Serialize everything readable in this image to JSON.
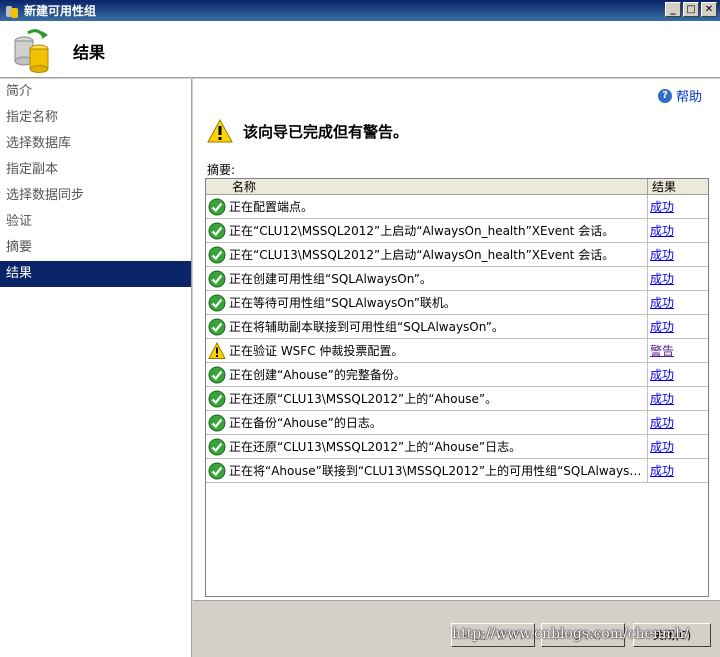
{
  "window": {
    "title": "新建可用性组"
  },
  "header": {
    "title": "结果"
  },
  "sidebar": {
    "items": [
      {
        "label": "简介"
      },
      {
        "label": "指定名称"
      },
      {
        "label": "选择数据库"
      },
      {
        "label": "指定副本"
      },
      {
        "label": "选择数据同步"
      },
      {
        "label": "验证"
      },
      {
        "label": "摘要"
      },
      {
        "label": "结果",
        "active": true
      }
    ]
  },
  "main": {
    "help_label": "帮助",
    "warning_heading": "该向导已完成但有警告。",
    "summary_label": "摘要:",
    "columns": {
      "name": "名称",
      "result": "结果"
    },
    "rows": [
      {
        "status": "success",
        "text": "正在配置端点。",
        "result": "成功"
      },
      {
        "status": "success",
        "text": "正在“CLU12\\MSSQL2012”上启动“AlwaysOn_health”XEvent 会话。",
        "result": "成功"
      },
      {
        "status": "success",
        "text": "正在“CLU13\\MSSQL2012”上启动“AlwaysOn_health”XEvent 会话。",
        "result": "成功"
      },
      {
        "status": "success",
        "text": "正在创建可用性组“SQLAlwaysOn”。",
        "result": "成功"
      },
      {
        "status": "success",
        "text": "正在等待可用性组“SQLAlwaysOn”联机。",
        "result": "成功"
      },
      {
        "status": "success",
        "text": "正在将辅助副本联接到可用性组“SQLAlwaysOn”。",
        "result": "成功"
      },
      {
        "status": "warning",
        "text": "正在验证 WSFC 仲裁投票配置。",
        "result": "警告"
      },
      {
        "status": "success",
        "text": "正在创建“Ahouse”的完整备份。",
        "result": "成功"
      },
      {
        "status": "success",
        "text": "正在还原“CLU13\\MSSQL2012”上的“Ahouse”。",
        "result": "成功"
      },
      {
        "status": "success",
        "text": "正在备份“Ahouse”的日志。",
        "result": "成功"
      },
      {
        "status": "success",
        "text": "正在还原“CLU13\\MSSQL2012”上的“Ahouse”日志。",
        "result": "成功"
      },
      {
        "status": "success",
        "text": "正在将“Ahouse”联接到“CLU13\\MSSQL2012”上的可用性组“SQLAlwaysOn...",
        "result": "成功"
      }
    ]
  },
  "footer": {
    "prev_label": "< 上一步(P)",
    "next_label": "下一步(N) >",
    "close_label": "关闭(C)"
  },
  "watermark": "http://www.cnblogs.com/chenmh/"
}
